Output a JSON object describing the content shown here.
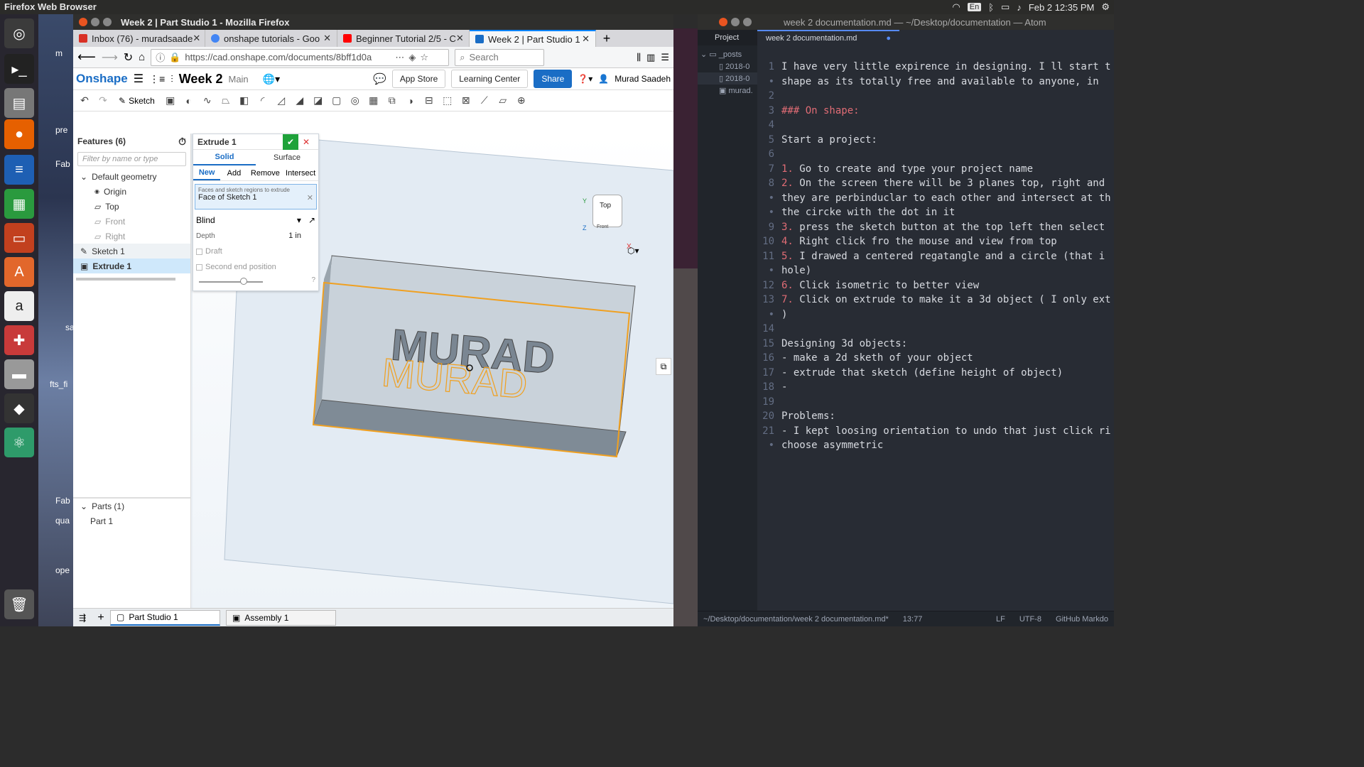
{
  "topbar": {
    "app_name": "Firefox Web Browser",
    "keyboard": "En",
    "datetime": "Feb 2 12:35 PM"
  },
  "desktop": {
    "labels": [
      "m",
      "pre",
      "Fab",
      "sa",
      "fts_fi",
      "Fab",
      "qua",
      "ope"
    ]
  },
  "firefox": {
    "window_title": "Week 2 | Part Studio 1 - Mozilla Firefox",
    "tabs": [
      {
        "label": "Inbox (76) - muradsaade"
      },
      {
        "label": "onshape tutorials - Goo"
      },
      {
        "label": "Beginner Tutorial 2/5 - C"
      },
      {
        "label": "Week 2 | Part Studio 1"
      }
    ],
    "url": "https://cad.onshape.com/documents/8bff1d0a",
    "url_domain": "onshape.com",
    "search_placeholder": "Search"
  },
  "onshape": {
    "logo": "Onshape",
    "doc_title": "Week 2",
    "branch": "Main",
    "sketch_label": "Sketch",
    "app_store": "App Store",
    "learning_center": "Learning Center",
    "share": "Share",
    "user": "Murad Saadeh",
    "features_title": "Features (6)",
    "filter_placeholder": "Filter by name or type",
    "feature_tree": {
      "default_geometry": "Default geometry",
      "origin": "Origin",
      "top": "Top",
      "front": "Front",
      "right": "Right",
      "sketch": "Sketch 1",
      "extrude": "Extrude 1"
    },
    "parts_title": "Parts (1)",
    "part": "Part 1",
    "extrude_panel": {
      "title": "Extrude 1",
      "type_solid": "Solid",
      "type_surface": "Surface",
      "op_new": "New",
      "op_add": "Add",
      "op_remove": "Remove",
      "op_intersect": "Intersect",
      "faces_label": "Faces and sketch regions to extrude",
      "faces_value": "Face of Sketch 1",
      "end_type": "Blind",
      "depth_label": "Depth",
      "depth_value": "1 in",
      "draft": "Draft",
      "second_end": "Second end position"
    },
    "viewcube": {
      "top": "Top",
      "front": "Front",
      "axis_x": "X",
      "axis_y": "Y",
      "axis_z": "Z"
    },
    "model_text": "MURAD",
    "bottom_tabs": [
      "Part Studio 1",
      "Assembly 1"
    ]
  },
  "atom": {
    "window_title": "week 2 documentation.md — ~/Desktop/documentation — Atom",
    "left_fragment": "mu",
    "tree_header": "Project",
    "tree_items": [
      "_posts",
      "2018-0",
      "2018-0",
      "murad."
    ],
    "editor_tab": "week 2 documentation.md",
    "lines": [
      {
        "n": "1",
        "t": "I have very little expirence in designing. I ll start t"
      },
      {
        "n": "•",
        "t": "shape as its totally free and available to anyone, in"
      },
      {
        "n": "2",
        "t": ""
      },
      {
        "n": "3",
        "t": "### On shape:",
        "h": true
      },
      {
        "n": "4",
        "t": ""
      },
      {
        "n": "5",
        "t": "Start a project:"
      },
      {
        "n": "6",
        "t": ""
      },
      {
        "n": "7",
        "num": "1.",
        "t": " Go to create and type your project name"
      },
      {
        "n": "8",
        "num": "2.",
        "t": " On the screen there will be 3 planes top, right and"
      },
      {
        "n": "•",
        "t": "they are perbinduclar to each other and intersect at th"
      },
      {
        "n": "•",
        "t": "the circke with the dot in it"
      },
      {
        "n": "9",
        "num": "3.",
        "t": " press the sketch button at the top left then select"
      },
      {
        "n": "10",
        "num": "4.",
        "t": "  Right click fro the mouse and view from top"
      },
      {
        "n": "11",
        "num": "5.",
        "t": " I drawed a centered regatangle and a circle (that i"
      },
      {
        "n": "•",
        "t": "hole)"
      },
      {
        "n": "12",
        "num": "6.",
        "t": " Click isometric to better view"
      },
      {
        "n": "13",
        "num": "7.",
        "t": " Click on extrude to make it a 3d object ( I only ext"
      },
      {
        "n": "•",
        "t": ")"
      },
      {
        "n": "14",
        "t": ""
      },
      {
        "n": "15",
        "t": "Designing 3d objects:"
      },
      {
        "n": "16",
        "t": "- make a 2d sketh of your object"
      },
      {
        "n": "17",
        "t": "- extrude that sketch (define height of object)"
      },
      {
        "n": "18",
        "t": "-"
      },
      {
        "n": "19",
        "t": ""
      },
      {
        "n": "20",
        "t": "Problems:"
      },
      {
        "n": "21",
        "t": "- I kept loosing orientation to undo that just click ri"
      },
      {
        "n": "•",
        "t": "choose asymmetric"
      }
    ],
    "status_path": "~/Desktop/documentation/week 2 documentation.md*",
    "status_pos": "13:77",
    "status_eol": "LF",
    "status_enc": "UTF-8",
    "status_grammar": "GitHub Markdo"
  }
}
